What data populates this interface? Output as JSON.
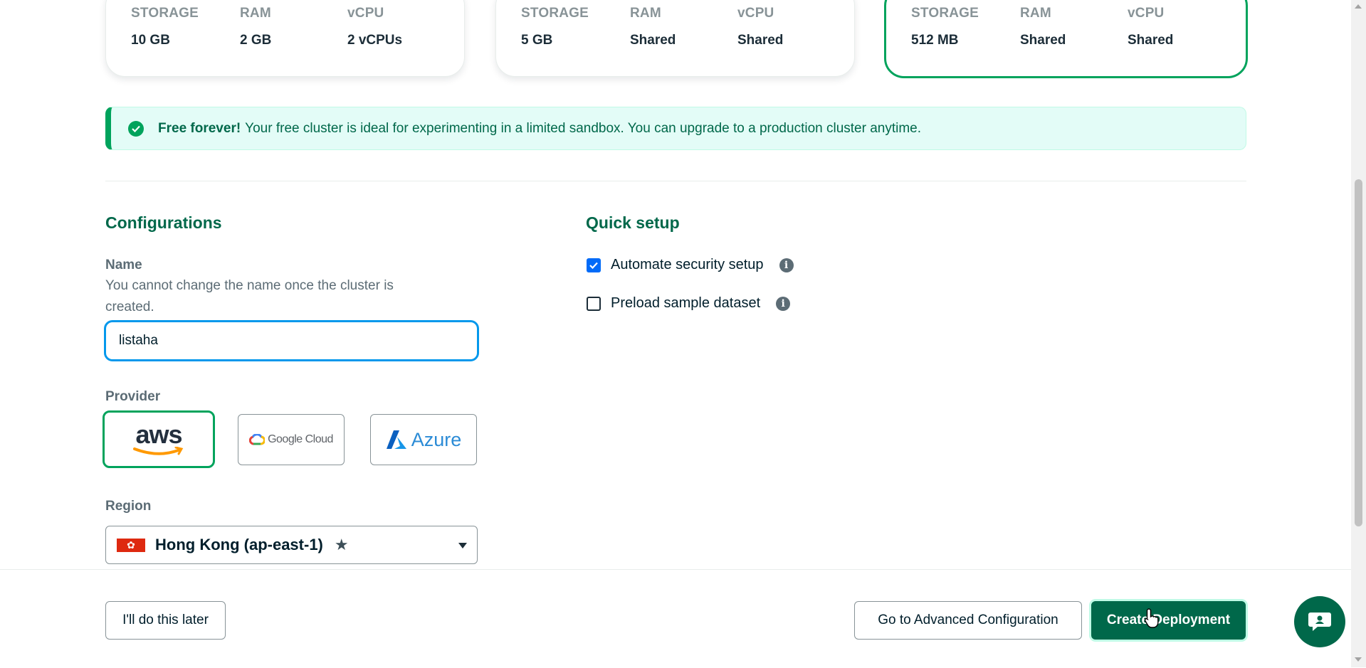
{
  "tiers": [
    {
      "specs": [
        {
          "label": "STORAGE",
          "value": "10 GB"
        },
        {
          "label": "RAM",
          "value": "2 GB"
        },
        {
          "label": "vCPU",
          "value": "2 vCPUs"
        }
      ]
    },
    {
      "specs": [
        {
          "label": "STORAGE",
          "value": "5 GB"
        },
        {
          "label": "RAM",
          "value": "Shared"
        },
        {
          "label": "vCPU",
          "value": "Shared"
        }
      ]
    },
    {
      "selected": true,
      "specs": [
        {
          "label": "STORAGE",
          "value": "512 MB"
        },
        {
          "label": "RAM",
          "value": "Shared"
        },
        {
          "label": "vCPU",
          "value": "Shared"
        }
      ]
    }
  ],
  "banner": {
    "strong": "Free forever!",
    "text": "Your free cluster is ideal for experimenting in a limited sandbox. You can upgrade to a production cluster anytime."
  },
  "configurations": {
    "title": "Configurations",
    "name_label": "Name",
    "name_description": "You cannot change the name once the cluster is created.",
    "name_value": "listaha",
    "provider_label": "Provider",
    "providers": [
      {
        "id": "aws",
        "label": "aws",
        "selected": true
      },
      {
        "id": "gcp",
        "label": "Google Cloud",
        "selected": false
      },
      {
        "id": "azure",
        "label": "Azure",
        "selected": false
      }
    ],
    "region_label": "Region",
    "region_value": "Hong Kong (ap-east-1)",
    "region_flag_icon": "hong-kong-flag-icon"
  },
  "quick_setup": {
    "title": "Quick setup",
    "options": [
      {
        "label": "Automate security setup",
        "checked": true
      },
      {
        "label": "Preload sample dataset",
        "checked": false
      }
    ]
  },
  "footer": {
    "later_button": "I'll do this later",
    "advanced_button": "Go to Advanced Configuration",
    "create_button": "Create Deployment"
  },
  "colors": {
    "brand_green": "#00684a",
    "accent_green": "#00a35c",
    "focus_blue": "#0498ec",
    "checkbox_blue": "#016bf8"
  }
}
